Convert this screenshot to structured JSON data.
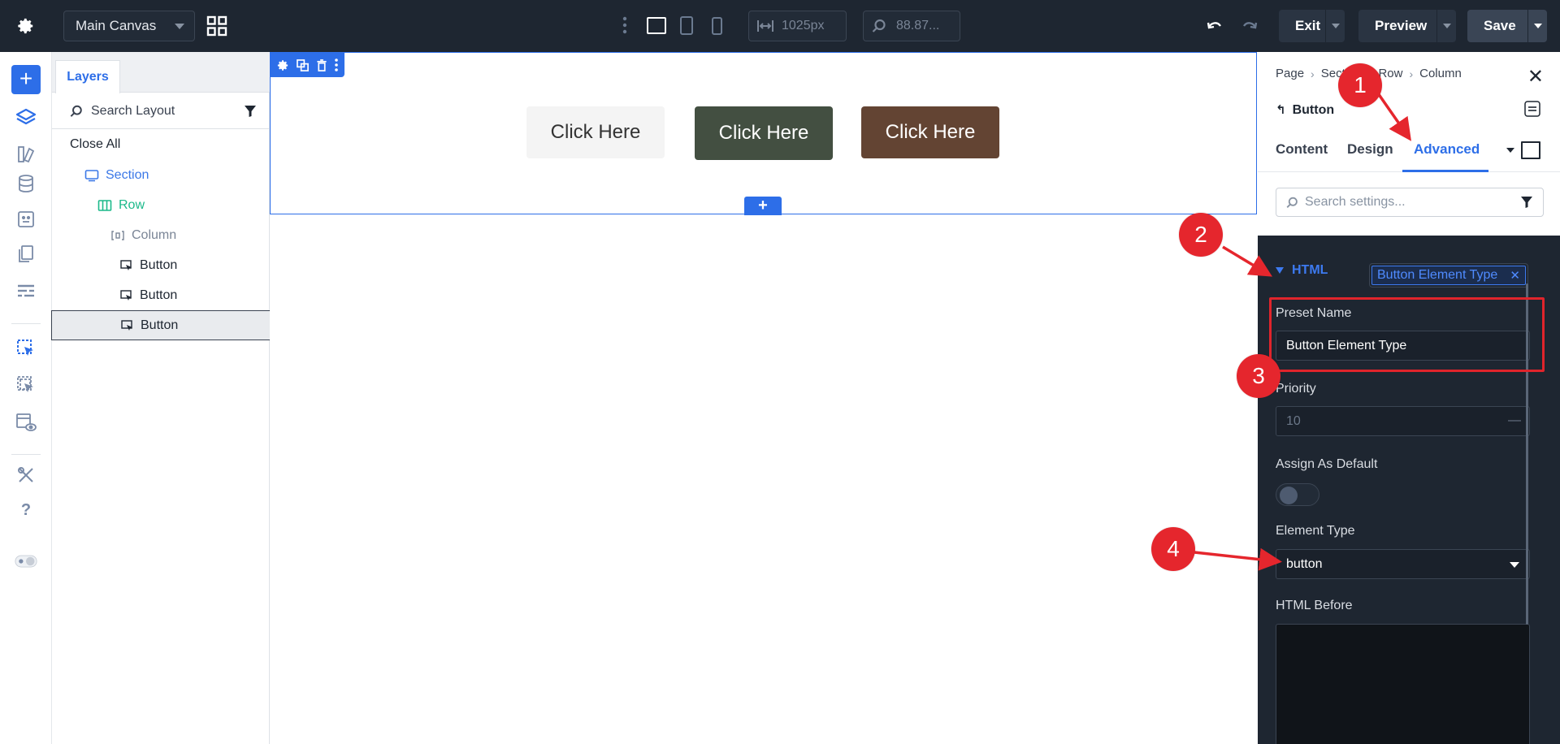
{
  "topbar": {
    "canvas_select": "Main Canvas",
    "width_value": "1025px",
    "zoom_value": "88.87...",
    "exit_label": "Exit",
    "preview_label": "Preview",
    "save_label": "Save"
  },
  "layers": {
    "tab_label": "Layers",
    "search_placeholder": "Search Layout",
    "close_all": "Close All",
    "items": [
      {
        "label": "Section",
        "type": "section",
        "color": "#3b78e7"
      },
      {
        "label": "Row",
        "type": "row",
        "color": "#1bb98a"
      },
      {
        "label": "Column",
        "type": "column",
        "color": "#7a8596"
      },
      {
        "label": "Button",
        "type": "module",
        "color": "#1e2631"
      },
      {
        "label": "Button",
        "type": "module",
        "color": "#1e2631"
      },
      {
        "label": "Button",
        "type": "module",
        "color": "#1e2631",
        "selected": true
      }
    ]
  },
  "canvas": {
    "buttons": [
      {
        "label": "Click Here",
        "bg": "#f4f4f4",
        "fg": "#333333"
      },
      {
        "label": "Click Here",
        "bg": "#434f41",
        "fg": "#ffffff"
      },
      {
        "label": "Click Here",
        "bg": "#634433",
        "fg": "#ffffff"
      }
    ]
  },
  "settings": {
    "breadcrumb": [
      "Page",
      "Section",
      "Row",
      "Column"
    ],
    "element_title": "Button",
    "tabs": [
      {
        "label": "Content",
        "active": false
      },
      {
        "label": "Design",
        "active": false
      },
      {
        "label": "Advanced",
        "active": true
      }
    ],
    "search_placeholder": "Search settings...",
    "group_title": "HTML",
    "preset_chip": "Button Element Type",
    "preset_name_label": "Preset Name",
    "preset_name_value": "Button Element Type",
    "priority_label": "Priority",
    "priority_value": "10",
    "assign_default_label": "Assign As Default",
    "assign_default_on": false,
    "element_type_label": "Element Type",
    "element_type_value": "button",
    "html_before_label": "HTML Before"
  },
  "annotations": [
    "1",
    "2",
    "3",
    "4"
  ],
  "colors": {
    "accent": "#2d6ee8",
    "dark_bg": "#1e2631",
    "annotation_red": "#e5262d"
  }
}
